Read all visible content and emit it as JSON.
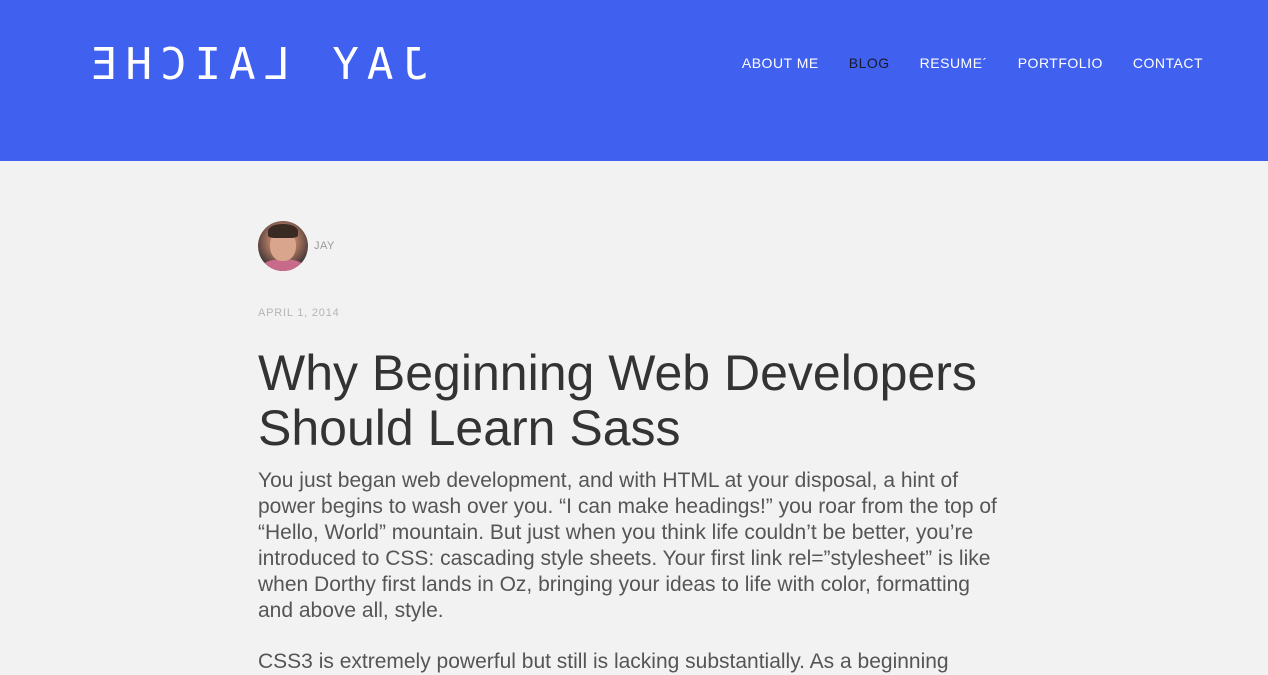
{
  "header": {
    "logo_text": "JAY LAICHE",
    "background_color": "#4060ef",
    "nav": [
      {
        "label": "ABOUT ME",
        "active": false
      },
      {
        "label": "BLOG",
        "active": true
      },
      {
        "label": "RESUME´",
        "active": false
      },
      {
        "label": "PORTFOLIO",
        "active": false
      },
      {
        "label": "CONTACT",
        "active": false
      }
    ]
  },
  "post": {
    "author": "JAY",
    "date": "APRIL 1, 2014",
    "title": "Why Beginning Web Developers Should Learn Sass",
    "paragraphs": [
      "You just began web development, and with HTML at your disposal, a hint of power begins to wash over you. “I can make headings!” you roar from the top of “Hello, World” mountain. But just when you think life couldn’t be better, you’re introduced to CSS: cascading style sheets. Your first link rel=”stylesheet” is like when Dorthy first lands in Oz, bringing your ideas to life with color, formatting and above all, style.",
      "CSS3 is extremely powerful but still is lacking substantially. As a beginning"
    ]
  }
}
